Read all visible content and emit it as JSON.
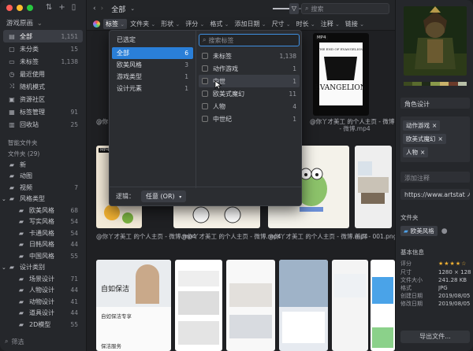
{
  "app": {
    "library_name": "游戏原画",
    "current_folder": "全部"
  },
  "sidebar": {
    "main_items": [
      {
        "label": "全部",
        "count": "1,151",
        "icon": "all-icon",
        "active": true
      },
      {
        "label": "未分类",
        "count": "15",
        "icon": "uncategorized-icon"
      },
      {
        "label": "未标签",
        "count": "1,138",
        "icon": "untagged-icon"
      },
      {
        "label": "最近使用",
        "count": "",
        "icon": "recent-icon"
      },
      {
        "label": "随机模式",
        "count": "",
        "icon": "random-icon"
      },
      {
        "label": "资源社区",
        "count": "",
        "icon": "community-icon"
      },
      {
        "label": "标签管理",
        "count": "91",
        "icon": "tag-manage-icon"
      },
      {
        "label": "回收站",
        "count": "25",
        "icon": "trash-icon"
      }
    ],
    "smart_folders_label": "智能文件夹",
    "folders_label": "文件夹 (29)",
    "folders": [
      {
        "label": "新",
        "count": "",
        "indent": 0
      },
      {
        "label": "动图",
        "count": "",
        "indent": 0
      },
      {
        "label": "视频",
        "count": "7",
        "indent": 0
      },
      {
        "label": "风格类型",
        "count": "",
        "indent": 0,
        "expanded": true
      },
      {
        "label": "欧美风格",
        "count": "68",
        "indent": 1
      },
      {
        "label": "写实风格",
        "count": "54",
        "indent": 1
      },
      {
        "label": "卡通风格",
        "count": "54",
        "indent": 1
      },
      {
        "label": "日韩风格",
        "count": "44",
        "indent": 1
      },
      {
        "label": "中国风格",
        "count": "55",
        "indent": 1
      },
      {
        "label": "设计类别",
        "count": "",
        "indent": 0,
        "expanded": true
      },
      {
        "label": "场景设计",
        "count": "71",
        "indent": 1
      },
      {
        "label": "人物设计",
        "count": "44",
        "indent": 1
      },
      {
        "label": "动物设计",
        "count": "41",
        "indent": 1
      },
      {
        "label": "道具设计",
        "count": "44",
        "indent": 1
      },
      {
        "label": "2D模型",
        "count": "55",
        "indent": 1
      }
    ],
    "filter_placeholder": "筛选"
  },
  "filterbar": {
    "items": [
      "标签",
      "文件夹",
      "形状",
      "评分",
      "格式",
      "添加日期",
      "尺寸",
      "时长",
      "注释",
      "链接"
    ],
    "active_index": 0
  },
  "toolbar": {
    "search_placeholder": "搜索",
    "zoom": 0.45
  },
  "tag_popup": {
    "left_items": [
      {
        "label": "已选定",
        "count": ""
      },
      {
        "label": "全部",
        "count": "6",
        "selected": true
      },
      {
        "label": "欧美风格",
        "count": "3"
      },
      {
        "label": "游戏类型",
        "count": "1"
      },
      {
        "label": "设计元素",
        "count": "1"
      }
    ],
    "search_placeholder": "搜索标签",
    "tags": [
      {
        "label": "未标签",
        "count": "1,138"
      },
      {
        "label": "动作游戏",
        "count": "1"
      },
      {
        "label": "中世",
        "count": "1",
        "hover": true
      },
      {
        "label": "欧美式魔幻",
        "count": "11"
      },
      {
        "label": "人物",
        "count": "4"
      },
      {
        "label": "中世纪",
        "count": "1"
      }
    ],
    "logic_label": "逻辑：",
    "logic_value": "任意 (OR)"
  },
  "grid": {
    "captions": [
      "@你丫才美工 的个人主页 - 微博.mp4",
      "@你丫才美工 的个人主页 - 微博.mp4",
      "@你丫才美工 的个人主页 - 微博.mp4",
      "@你丫才美工 的个人主页 - 微博.mp4",
      "@你丫才美工 的个人主页 - 微博.mp4",
      "@你丫才美工 的个人主页 - 微博.mp4",
      "首页 - 001.png"
    ],
    "badge": "MP4",
    "poster_title": "THE END OF EVANGELION",
    "app_texts": [
      "自如保洁",
      "自如保洁专享",
      "保洁服务"
    ]
  },
  "right_panel": {
    "title_field": "角色设计",
    "tags": [
      "动作游戏",
      "欧美式魔幻",
      "人物"
    ],
    "note_placeholder": "添加注释",
    "url": "https://www.artstat",
    "folder_label": "文件夹",
    "folder_tag": "欧美风格",
    "info_label": "基本信息",
    "rating_label": "评分",
    "rating": 4,
    "info": [
      {
        "k": "尺寸",
        "v": "1280 × 1280"
      },
      {
        "k": "文件大小",
        "v": "241.28 KB"
      },
      {
        "k": "格式",
        "v": "JPG"
      },
      {
        "k": "创建日期",
        "v": "2019/08/05 18:"
      },
      {
        "k": "修改日期",
        "v": "2019/08/05 18:"
      }
    ],
    "export_label": "导出文件..."
  },
  "colors": {
    "accent": "#2a7fd8",
    "folder": "#4ea1e8",
    "palette": [
      "#3c4a1f",
      "#5a6b2e",
      "#1f2a18",
      "#8a9a4a",
      "#c9b26a",
      "#6b3b2a",
      "#b8c0a8"
    ]
  }
}
